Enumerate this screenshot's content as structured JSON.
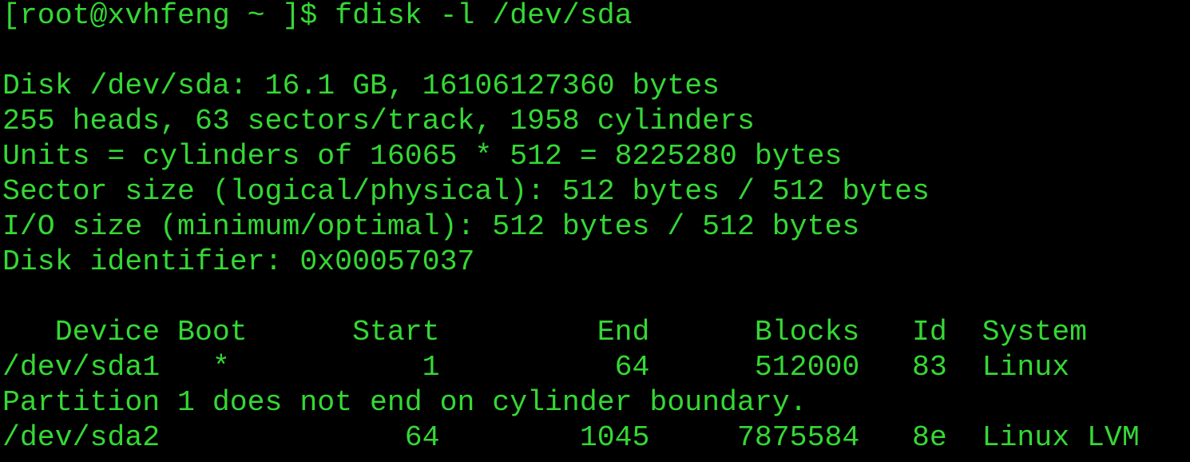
{
  "terminal": {
    "text_color": "#35d835",
    "background": "#000000",
    "lines": [
      "[root@xvhfeng ~ ]$ fdisk -l /dev/sda",
      "",
      "Disk /dev/sda: 16.1 GB, 16106127360 bytes",
      "255 heads, 63 sectors/track, 1958 cylinders",
      "Units = cylinders of 16065 * 512 = 8225280 bytes",
      "Sector size (logical/physical): 512 bytes / 512 bytes",
      "I/O size (minimum/optimal): 512 bytes / 512 bytes",
      "Disk identifier: 0x00057037",
      "",
      "   Device Boot      Start         End      Blocks   Id  System",
      "/dev/sda1   *           1          64      512000   83  Linux",
      "Partition 1 does not end on cylinder boundary.",
      "/dev/sda2              64        1045     7875584   8e  Linux LVM"
    ]
  }
}
